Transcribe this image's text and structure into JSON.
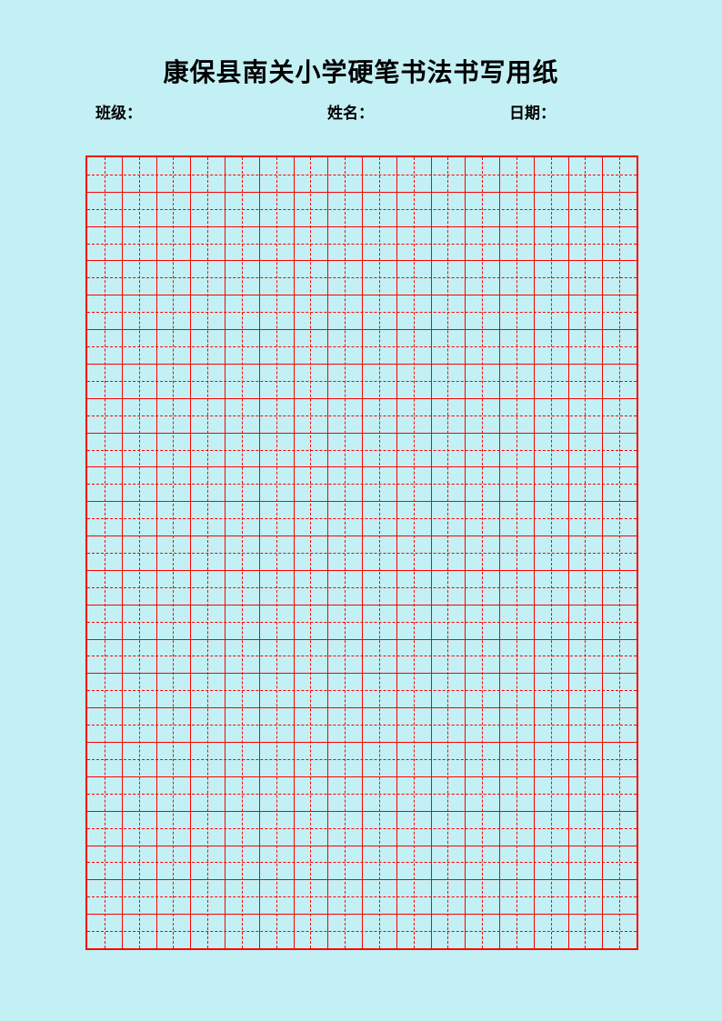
{
  "header": {
    "title": "康保县南关小学硬笔书法书写用纸",
    "class_label": "班级：",
    "name_label": "姓名：",
    "date_label": "日期："
  },
  "grid": {
    "columns": 16,
    "rows": 23,
    "border_color": "#ff0000",
    "line_style_main": "solid",
    "line_style_mid": "dashed"
  },
  "page": {
    "background": "#c3f0f4"
  }
}
